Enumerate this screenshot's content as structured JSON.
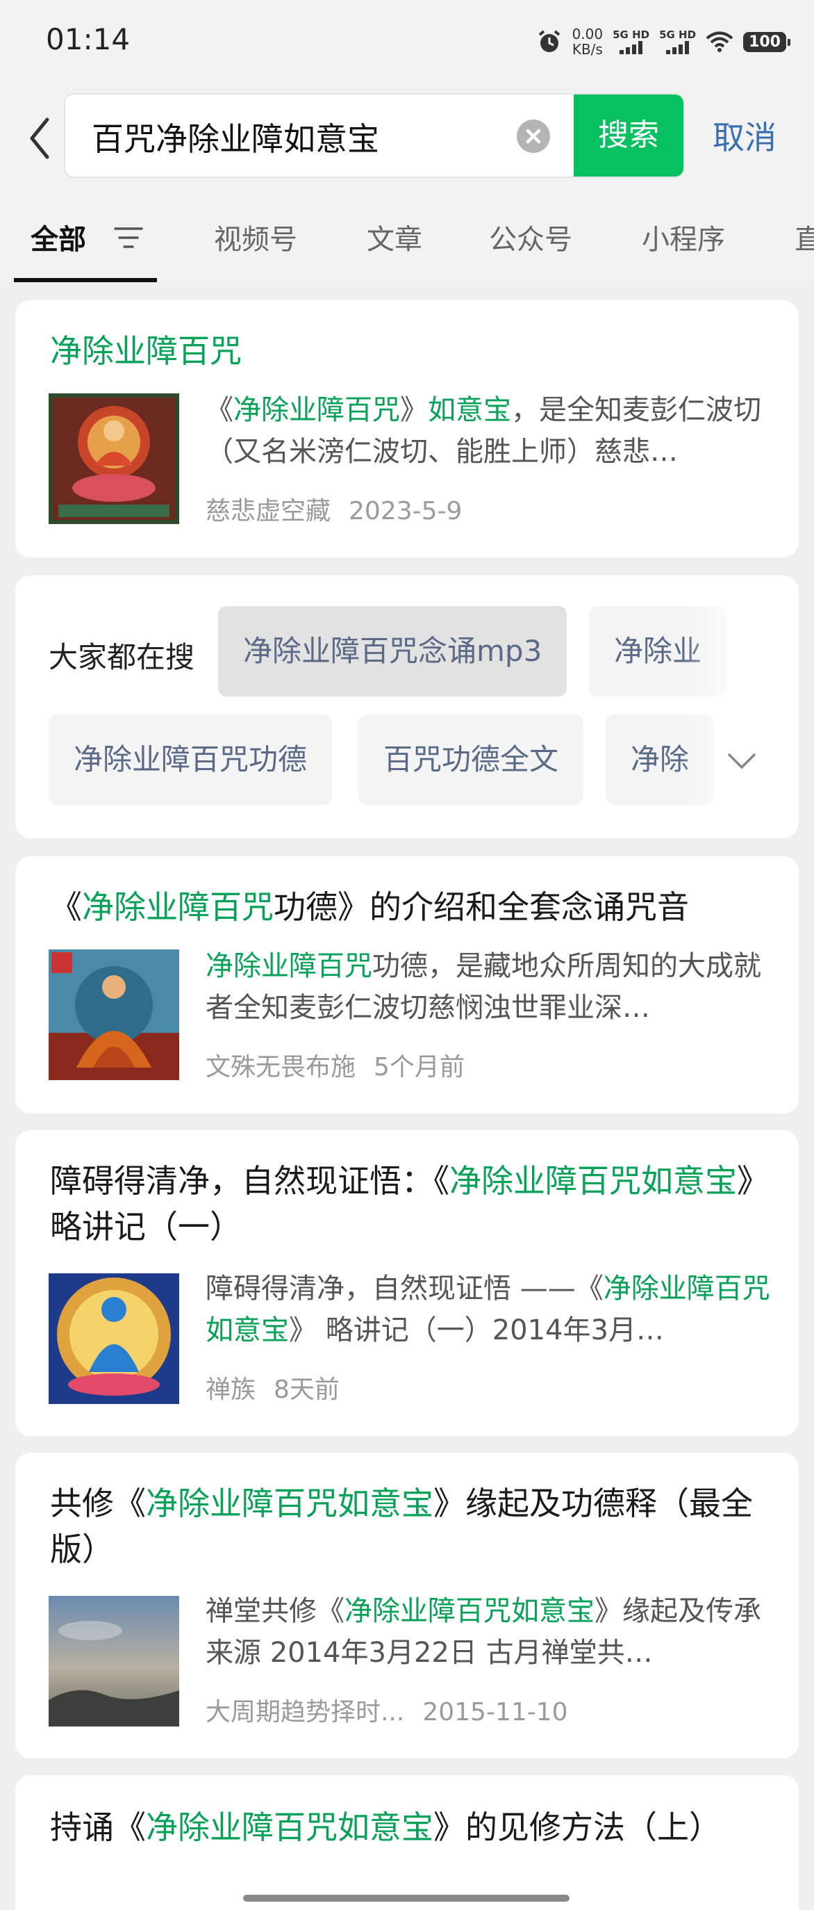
{
  "status_bar": {
    "time": "01:14",
    "net_speed_value": "0.00",
    "net_speed_unit": "KB/s",
    "sim1_label": "5G HD",
    "sim2_label": "5G HD",
    "battery": "100",
    "icons": [
      "alarm-icon",
      "signal-icon",
      "wifi-icon",
      "battery-icon"
    ]
  },
  "search": {
    "query": "百咒净除业障如意宝",
    "search_button": "搜索",
    "cancel": "取消"
  },
  "tabs": [
    "全部",
    "视频号",
    "文章",
    "公众号",
    "小程序",
    "直"
  ],
  "results": [
    {
      "title_hl": "净除业障百咒",
      "desc_pre": "《",
      "desc_hl1": "净除业障百咒",
      "desc_mid": "》",
      "desc_hl2": "如意宝",
      "desc_post": "，是全知麦彭仁波切（又名米滂仁波切、能胜上师）慈悲…",
      "source": "慈悲虚空藏",
      "date": "2023-5-9"
    },
    {
      "title_pre": "《",
      "title_hl": "净除业障百咒",
      "title_post": "功德》的介绍和全套念诵咒音",
      "desc_hl": "净除业障百咒",
      "desc_post": "功德，是藏地众所周知的大成就者全知麦彭仁波切慈悯浊世罪业深…",
      "source": "文殊无畏布施",
      "date": "5个月前"
    },
    {
      "title_pre": "障碍得清净，自然现证悟：《",
      "title_hl": "净除业障百咒如意宝",
      "title_post": "》略讲记（一）",
      "desc_pre": "障碍得清净，自然现证悟 ——《",
      "desc_hl": "净除业障百咒如意宝",
      "desc_post": "》 略讲记（一）2014年3月…",
      "source": "禅族",
      "date": "8天前"
    },
    {
      "title_pre": "共修《",
      "title_hl": "净除业障百咒如意宝",
      "title_post": "》缘起及功德释（最全版）",
      "desc_pre": "禅堂共修《",
      "desc_hl": "净除业障百咒如意宝",
      "desc_post": "》缘起及传承来源 2014年3月22日 古月禅堂共…",
      "source": "大周期趋势择时...",
      "date": "2015-11-10"
    },
    {
      "title_pre": "持诵《",
      "title_hl": "净除业障百咒如意宝",
      "title_post": "》的见修方法（上）"
    }
  ],
  "related": {
    "label": "大家都在搜",
    "row1": [
      "净除业障百咒念诵mp3",
      "净除业"
    ],
    "row2": [
      "净除业障百咒功德",
      "百咒功德全文",
      "净除"
    ]
  },
  "colors": {
    "accent_green": "#07c160",
    "highlight_green": "#07a157",
    "link_blue": "#3a6fb0"
  }
}
